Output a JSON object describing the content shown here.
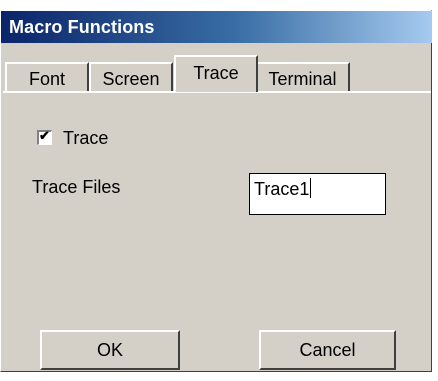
{
  "window": {
    "title": "Macro Functions"
  },
  "tabs": [
    {
      "label": "Font",
      "active": false
    },
    {
      "label": "Screen",
      "active": false
    },
    {
      "label": "Trace",
      "active": true
    },
    {
      "label": "Terminal",
      "active": false
    }
  ],
  "trace": {
    "checkbox_label": "Trace",
    "checked": true,
    "files_label": "Trace Files",
    "files_value": "Trace1"
  },
  "buttons": {
    "ok": "OK",
    "cancel": "Cancel"
  },
  "colors": {
    "title_start": "#0a246a",
    "title_end": "#a6caf0",
    "face": "#d4d0c8"
  }
}
